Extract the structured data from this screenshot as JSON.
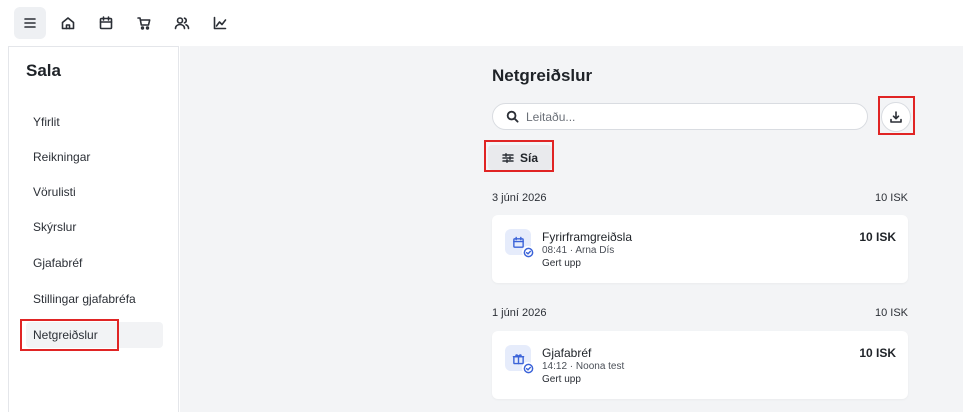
{
  "topnav": {
    "items": [
      {
        "icon": "menu-icon",
        "active": true
      },
      {
        "icon": "home-icon",
        "active": false
      },
      {
        "icon": "calendar-icon",
        "active": false
      },
      {
        "icon": "cart-icon",
        "active": false
      },
      {
        "icon": "users-icon",
        "active": false
      },
      {
        "icon": "chart-icon",
        "active": false
      }
    ]
  },
  "sidebar": {
    "title": "Sala",
    "items": [
      {
        "label": "Yfirlit",
        "active": false
      },
      {
        "label": "Reikningar",
        "active": false
      },
      {
        "label": "Vörulisti",
        "active": false
      },
      {
        "label": "Skýrslur",
        "active": false
      },
      {
        "label": "Gjafabréf",
        "active": false
      },
      {
        "label": "Stillingar gjafabréfa",
        "active": false
      },
      {
        "label": "Netgreiðslur",
        "active": true
      }
    ]
  },
  "main": {
    "title": "Netgreiðslur",
    "search": {
      "placeholder": "Leitaðu...",
      "value": ""
    },
    "filter_label": "Sía",
    "groups": [
      {
        "date": "3 júní 2026",
        "total": "10 ISK",
        "items": [
          {
            "icon": "calendar-icon",
            "name": "Fyrirframgreiðsla",
            "meta": "08:41 · Arna Dís",
            "status": "Gert upp",
            "amount": "10 ISK"
          }
        ]
      },
      {
        "date": "1 júní 2026",
        "total": "10 ISK",
        "items": [
          {
            "icon": "gift-icon",
            "name": "Gjafabréf",
            "meta": "14:12 · Noona test",
            "status": "Gert upp",
            "amount": "10 ISK"
          }
        ]
      }
    ]
  },
  "colors": {
    "accent": "#3b63d8",
    "highlight": "#e02424",
    "background": "#f3f4f6"
  }
}
